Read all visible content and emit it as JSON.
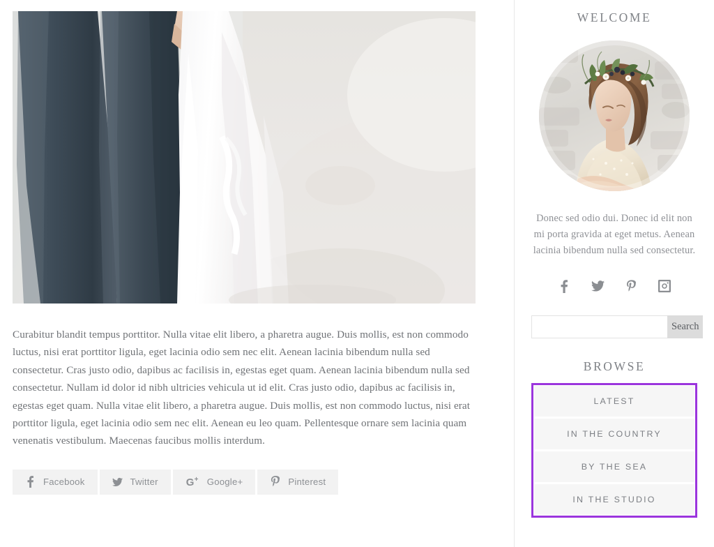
{
  "post": {
    "hero_alt": "bride-and-groom-holding-hands-photo",
    "body": "Curabitur blandit tempus porttitor. Nulla vitae elit libero, a pharetra augue. Duis mollis, est non commodo luctus, nisi erat porttitor ligula, eget lacinia odio sem nec elit. Aenean lacinia bibendum nulla sed consectetur. Cras justo odio, dapibus ac facilisis in, egestas eget quam. Aenean lacinia bibendum nulla sed consectetur. Nullam id dolor id nibh ultricies vehicula ut id elit. Cras justo odio, dapibus ac facilisis in, egestas eget quam. Nulla vitae elit libero, a pharetra augue. Duis mollis, est non commodo luctus, nisi erat porttitor ligula, eget lacinia odio sem nec elit. Aenean eu leo quam. Pellentesque ornare sem lacinia quam venenatis vestibulum. Maecenas faucibus mollis interdum."
  },
  "share_buttons": [
    {
      "label": "Facebook",
      "icon": "facebook-icon"
    },
    {
      "label": "Twitter",
      "icon": "twitter-icon"
    },
    {
      "label": "Google+",
      "icon": "google-plus-icon"
    },
    {
      "label": "Pinterest",
      "icon": "pinterest-icon"
    }
  ],
  "sidebar": {
    "welcome_heading": "WELCOME",
    "avatar_alt": "bride-with-floral-crown-portrait",
    "about_text": "Donec sed odio dui. Donec id elit non mi porta gravida at eget metus. Aenean lacinia bibendum nulla sed consectetur.",
    "social_links": [
      {
        "name": "facebook-icon"
      },
      {
        "name": "twitter-icon"
      },
      {
        "name": "pinterest-icon"
      },
      {
        "name": "instagram-icon"
      }
    ],
    "search": {
      "value": "",
      "placeholder": "",
      "button_label": "Search"
    },
    "browse_heading": "BROWSE",
    "browse_items": [
      {
        "label": "LATEST"
      },
      {
        "label": "IN THE COUNTRY"
      },
      {
        "label": "BY THE SEA"
      },
      {
        "label": "IN THE STUDIO"
      }
    ]
  },
  "colors": {
    "accent_border": "#9b35dd",
    "heading_text": "#7e8186",
    "body_text": "#6f7276",
    "button_bg": "#f2f2f2",
    "item_bg": "#f6f6f6",
    "search_button_bg": "#dcdcdc"
  }
}
